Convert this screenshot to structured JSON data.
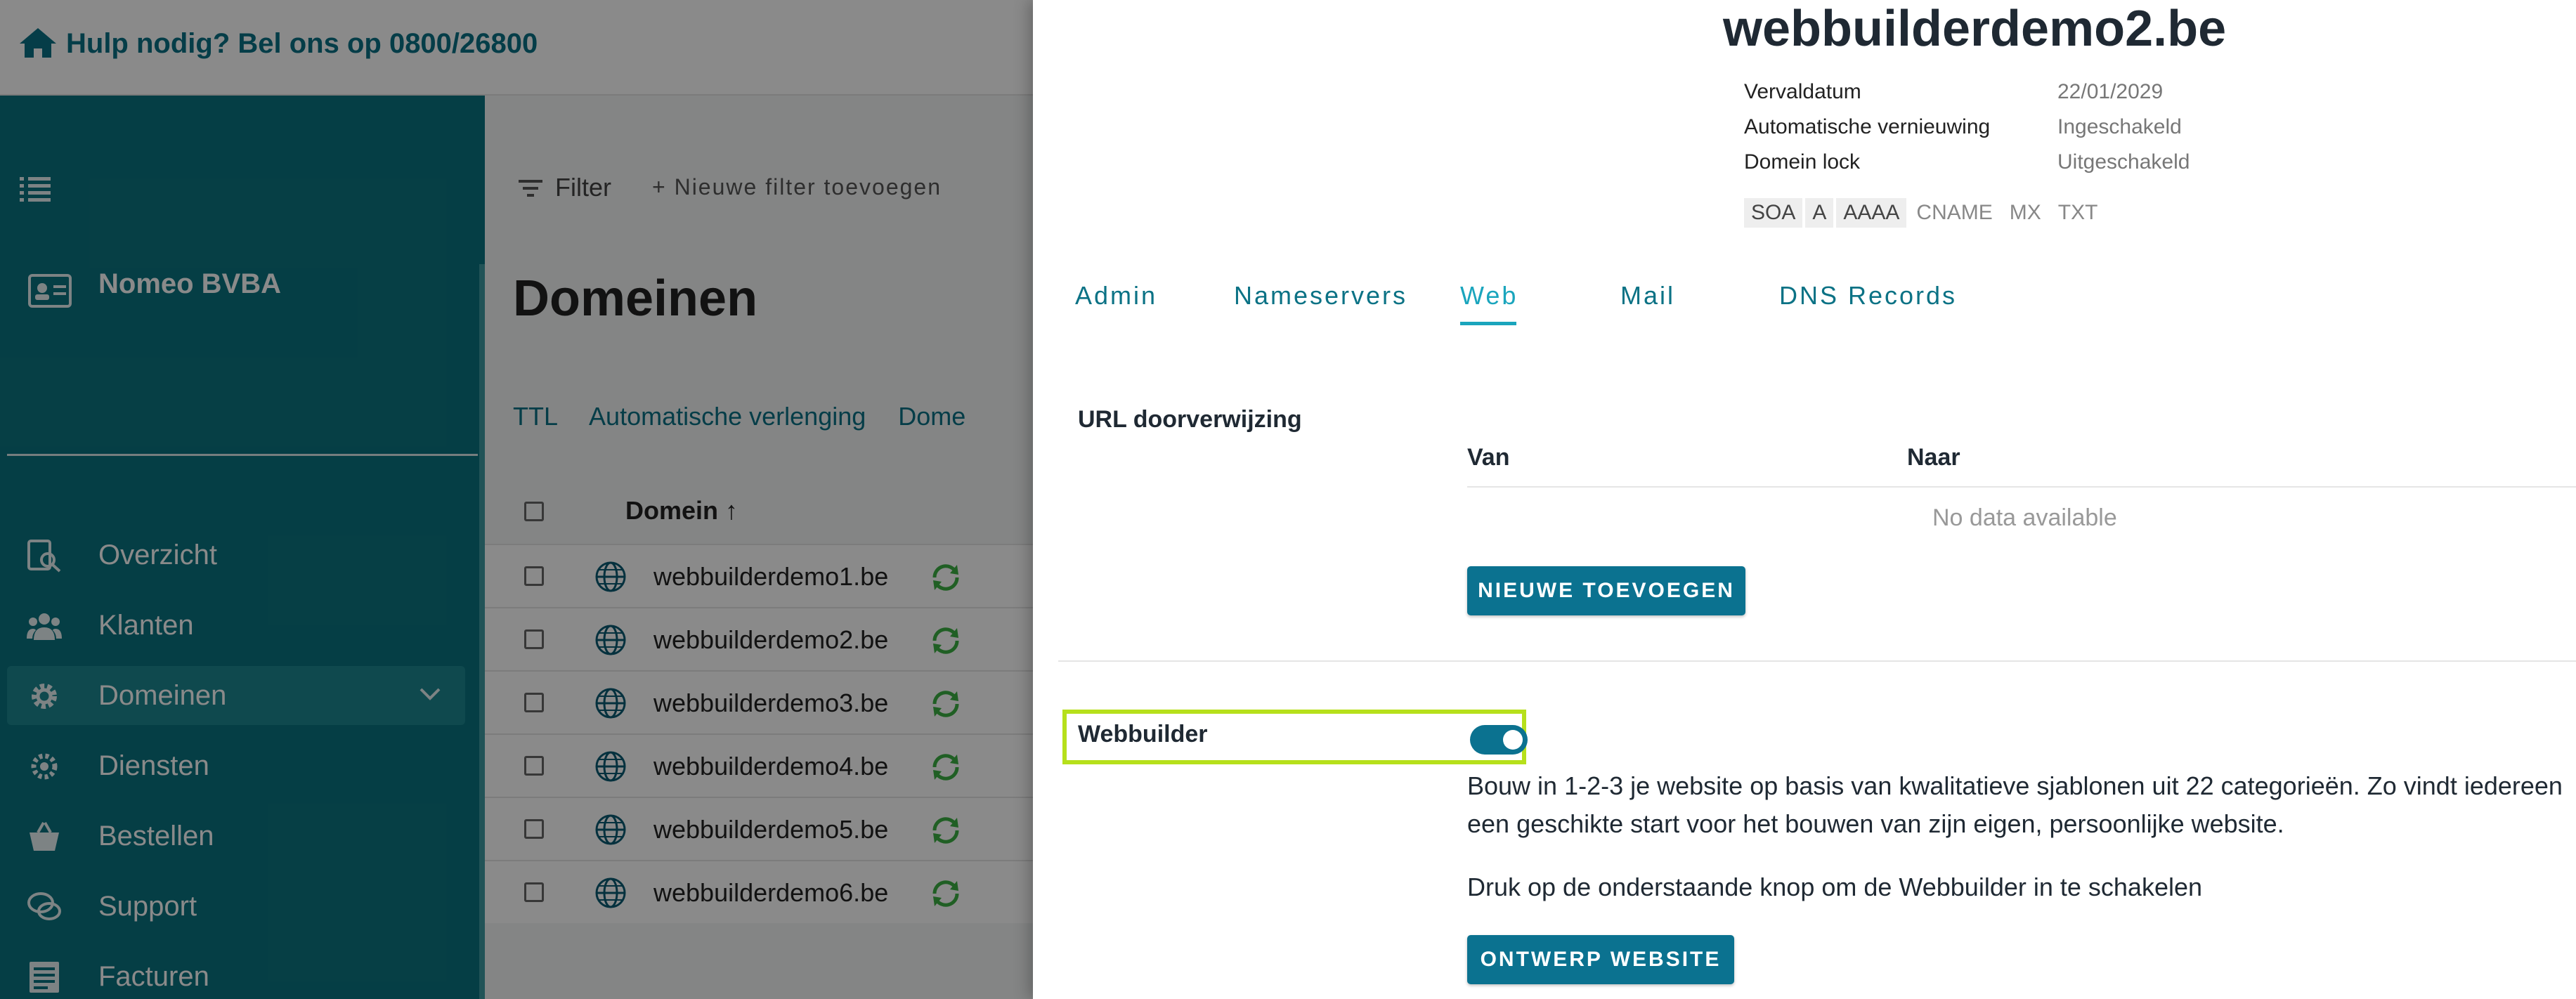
{
  "topbar": {
    "help_text": "Hulp nodig? Bel ons op 0800/26800"
  },
  "sidebar": {
    "company": "Nomeo BVBA",
    "items": [
      {
        "label": "Overzicht",
        "icon": "search-report-icon",
        "active": false
      },
      {
        "label": "Klanten",
        "icon": "users-icon",
        "active": false
      },
      {
        "label": "Domeinen",
        "icon": "gear-icon",
        "active": true
      },
      {
        "label": "Diensten",
        "icon": "cog-double-icon",
        "active": false
      },
      {
        "label": "Bestellen",
        "icon": "basket-icon",
        "active": false
      },
      {
        "label": "Support",
        "icon": "chat-icon",
        "active": false
      },
      {
        "label": "Facturen",
        "icon": "invoice-icon",
        "active": false
      }
    ]
  },
  "main": {
    "filter_label": "Filter",
    "new_filter_label": "+ Nieuwe filter toevoegen",
    "title": "Domeinen",
    "actions": [
      "TTL",
      "Automatische verlenging",
      "Dome"
    ],
    "column_domain": "Domein",
    "rows": [
      "webbuilderdemo1.be",
      "webbuilderdemo2.be",
      "webbuilderdemo3.be",
      "webbuilderdemo4.be",
      "webbuilderdemo5.be",
      "webbuilderdemo6.be"
    ]
  },
  "drawer": {
    "title": "webbuilderdemo2.be",
    "info": [
      {
        "key": "Vervaldatum",
        "value": "22/01/2029"
      },
      {
        "key": "Automatische vernieuwing",
        "value": "Ingeschakeld"
      },
      {
        "key": "Domein lock",
        "value": "Uitgeschakeld"
      }
    ],
    "records": [
      {
        "label": "SOA",
        "highlighted": true
      },
      {
        "label": "A",
        "highlighted": true
      },
      {
        "label": "AAAA",
        "highlighted": true
      },
      {
        "label": "CNAME",
        "highlighted": false
      },
      {
        "label": "MX",
        "highlighted": false
      },
      {
        "label": "TXT",
        "highlighted": false
      }
    ],
    "tabs": [
      {
        "label": "Admin",
        "active": false
      },
      {
        "label": "Nameservers",
        "active": false
      },
      {
        "label": "Web",
        "active": true
      },
      {
        "label": "Mail",
        "active": false
      },
      {
        "label": "DNS Records",
        "active": false
      }
    ],
    "url_section": {
      "label": "URL doorverwijzing",
      "col_from": "Van",
      "col_to": "Naar",
      "empty_text": "No data available",
      "add_button": "NIEUWE TOEVOEGEN"
    },
    "webbuilder": {
      "label": "Webbuilder",
      "enabled": true,
      "description": "Bouw in 1-2-3 je website op basis van kwalitatieve sjablonen uit 22 categorieën. Zo vindt iedereen een geschikte start voor het bouwen van zijn eigen, persoonlijke website.",
      "instruction": "Druk op de onderstaande knop om de Webbuilder in te schakelen",
      "design_button": "ONTWERP WEBSITE"
    }
  },
  "colors": {
    "primary": "#0b7290",
    "sidebar": "#0b7480",
    "highlight": "#b6e01b",
    "tab_active": "#1aa5bd"
  }
}
